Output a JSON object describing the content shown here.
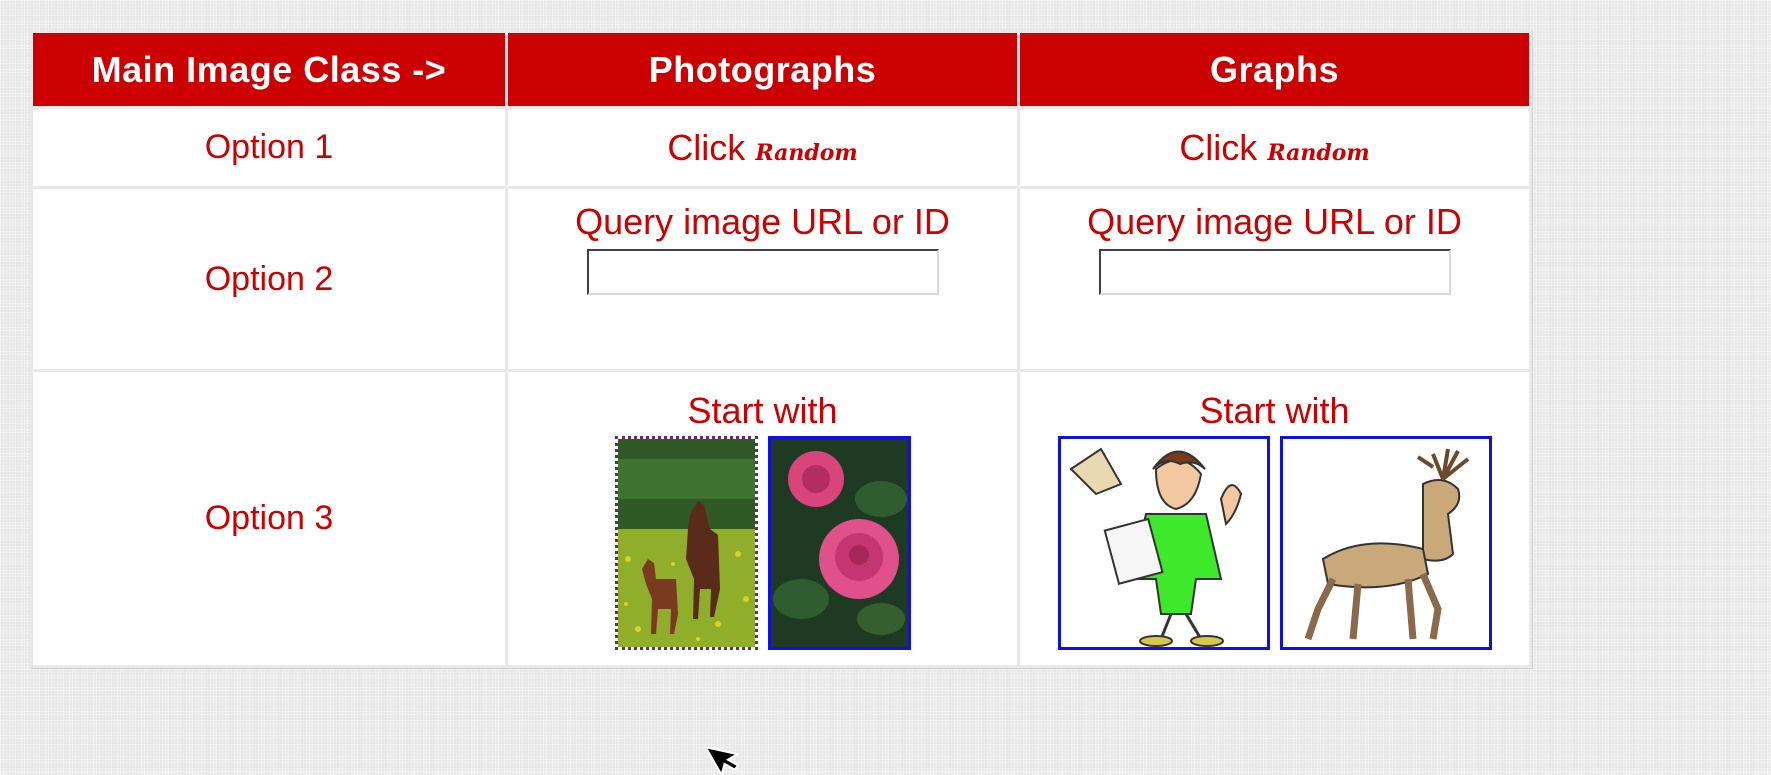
{
  "table": {
    "headers": [
      "Main Image Class ->",
      "Photographs",
      "Graphs"
    ],
    "option1": {
      "label": "Option 1",
      "photos": {
        "click": "Click",
        "random": "Random"
      },
      "graphs": {
        "click": "Click",
        "random": "Random"
      }
    },
    "option2": {
      "label": "Option 2",
      "photos": {
        "caption": "Query image URL or ID",
        "value": ""
      },
      "graphs": {
        "caption": "Query image URL or ID",
        "value": ""
      }
    },
    "option3": {
      "label": "Option 3",
      "photos": {
        "caption": "Start with",
        "thumbs": [
          "horses-photo",
          "rose-photo"
        ]
      },
      "graphs": {
        "caption": "Start with",
        "thumbs": [
          "woman-clipart",
          "deer-clipart"
        ]
      }
    }
  },
  "colors": {
    "header_bg": "#cc0000",
    "text_red": "#cc0000",
    "thumb_border": "#1010e0"
  }
}
